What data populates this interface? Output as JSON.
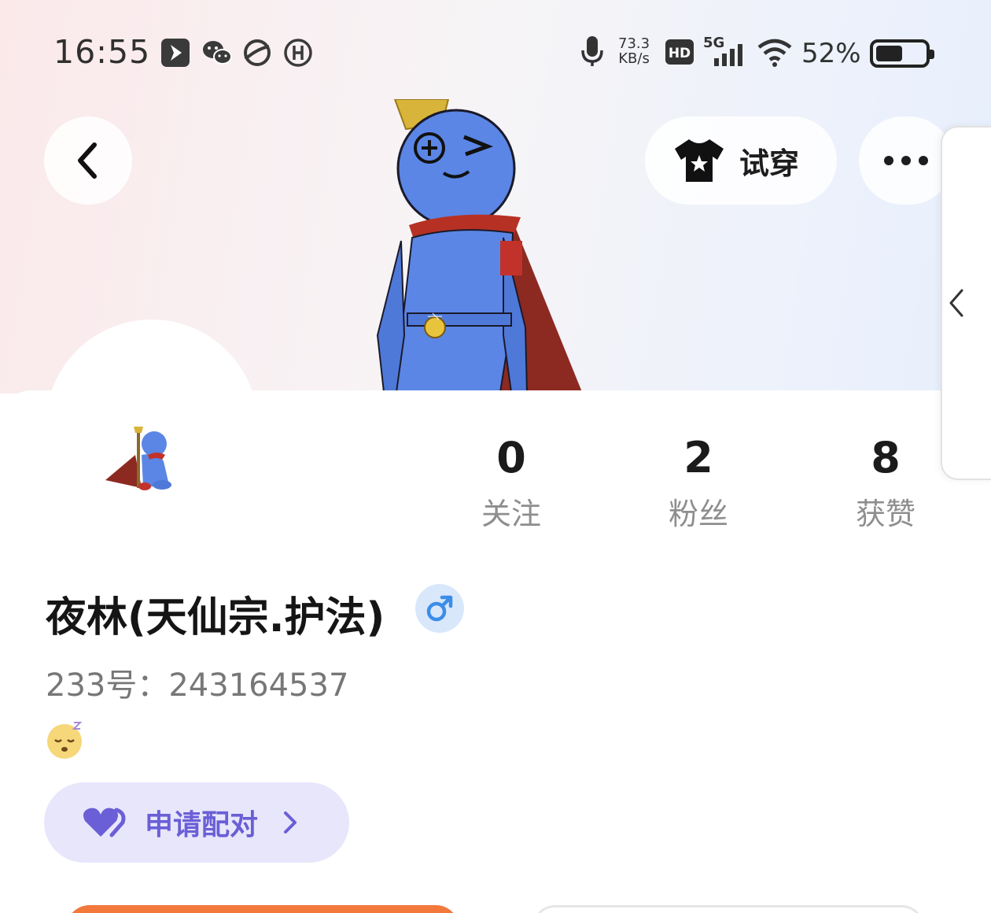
{
  "status_bar": {
    "time": "16:55",
    "net_speed_value": "73.3",
    "net_speed_unit": "KB/s",
    "hd": "HD",
    "network": "5G",
    "battery_percent": "52%",
    "battery_level": 0.52
  },
  "header": {
    "try_on_label": "试穿"
  },
  "stats": [
    {
      "value": "0",
      "label": "关注"
    },
    {
      "value": "2",
      "label": "粉丝"
    },
    {
      "value": "8",
      "label": "获赞"
    }
  ],
  "profile": {
    "nickname": "夜林(天仙宗.护法)",
    "gender_symbol": "♂",
    "uid_text": "233号：243164537"
  },
  "pair_button": {
    "label": "申请配对"
  },
  "colors": {
    "accent_purple": "#6a5fd6",
    "pair_bg": "#e8e6fb",
    "gender_blue": "#3b8de8",
    "bottom_orange": "#f2783c"
  }
}
